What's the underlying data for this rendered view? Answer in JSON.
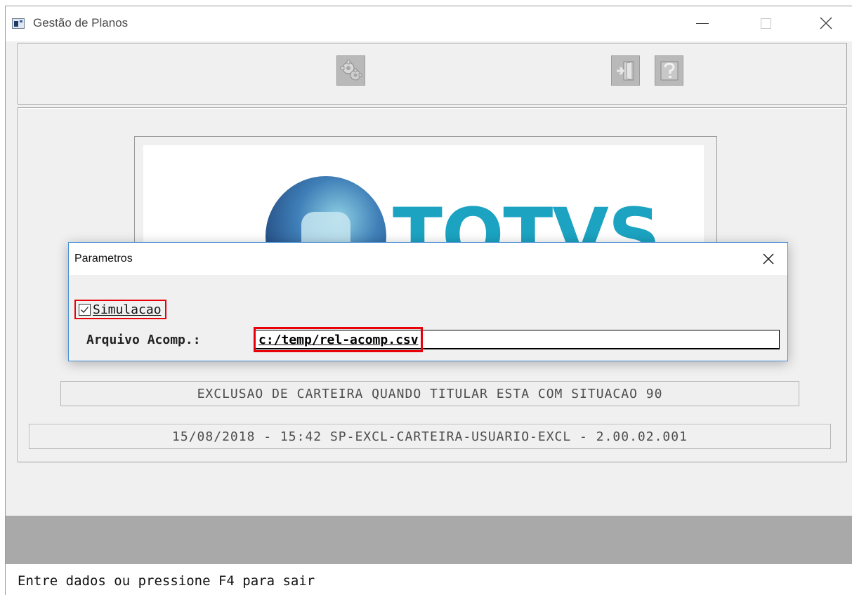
{
  "window": {
    "title": "Gestão de Planos"
  },
  "toolbar": {
    "buttons": [
      {
        "icon": "gears-icon",
        "label": ""
      },
      {
        "icon": "exit-door-icon",
        "label": ""
      },
      {
        "icon": "help-icon",
        "label": ""
      }
    ]
  },
  "logo": {
    "text": "TOTVS",
    "colors": {
      "text": "#1ba3c1",
      "sphere_dark": "#1d3f73",
      "sphere_light": "#8fd0e4"
    }
  },
  "main": {
    "description": "EXCLUSAO DE CARTEIRA QUANDO TITULAR ESTA COM SITUACAO 90",
    "version_line": "15/08/2018 - 15:42  SP-EXCL-CARTEIRA-USUARIO-EXCL - 2.00.02.001"
  },
  "dialog": {
    "title": "Parametros",
    "simulacao": {
      "label": "Simulacao",
      "checked": true
    },
    "arquivo": {
      "label": "Arquivo Acomp.:",
      "value": "c:/temp/rel-acomp.csv"
    }
  },
  "status": {
    "message": "Entre dados ou pressione F4 para sair"
  },
  "colors": {
    "highlight": "#e8000b",
    "dialog_border": "#4a90d9",
    "gray_bar": "#a9a9a9"
  }
}
